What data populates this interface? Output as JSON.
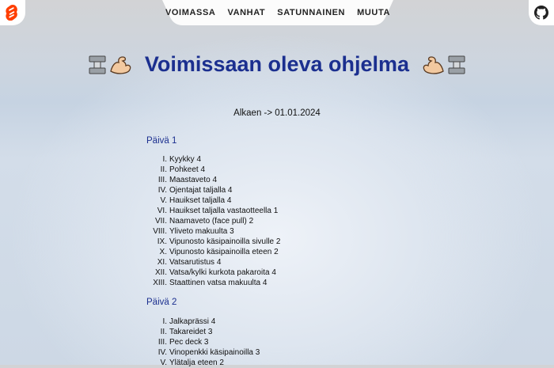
{
  "nav": {
    "items": [
      "VOIMASSA",
      "VANHAT",
      "SATUNNAINEN",
      "MUUTA"
    ]
  },
  "header": {
    "title": "Voimissaan oleva ohjelma",
    "start_label": "Alkaen -> 01.01.2024"
  },
  "days": [
    {
      "label": "Päivä 1",
      "exercises": [
        {
          "num": "I.",
          "text": "Kyykky 4"
        },
        {
          "num": "II.",
          "text": "Pohkeet 4"
        },
        {
          "num": "III.",
          "text": "Maastaveto 4"
        },
        {
          "num": "IV.",
          "text": "Ojentajat taljalla 4"
        },
        {
          "num": "V.",
          "text": "Hauikset taljalla 4"
        },
        {
          "num": "VI.",
          "text": "Hauikset taljalla vastaotteella 1"
        },
        {
          "num": "VII.",
          "text": "Naamaveto (face pull) 2"
        },
        {
          "num": "VIII.",
          "text": "Yliveto makuulta 3"
        },
        {
          "num": "IX.",
          "text": "Vipunosto käsipainoilla sivulle 2"
        },
        {
          "num": "X.",
          "text": "Vipunosto käsipainoilla eteen 2"
        },
        {
          "num": "XI.",
          "text": "Vatsarutistus 4"
        },
        {
          "num": "XII.",
          "text": "Vatsa/kylki kurkota pakaroita 4"
        },
        {
          "num": "XIII.",
          "text": "Staattinen vatsa makuulta 4"
        }
      ]
    },
    {
      "label": "Päivä 2",
      "exercises": [
        {
          "num": "I.",
          "text": "Jalkaprässi 4"
        },
        {
          "num": "II.",
          "text": "Takareidet 3"
        },
        {
          "num": "III.",
          "text": "Pec deck 3"
        },
        {
          "num": "IV.",
          "text": "Vinopenkki käsipainoilla 3"
        },
        {
          "num": "V.",
          "text": "Ylätalja eteen 2"
        }
      ]
    }
  ],
  "icons": {
    "left": "svelte-logo-icon",
    "right": "github-icon",
    "title_decor": [
      "dumbbell-icon",
      "flexed-biceps-icon"
    ]
  },
  "colors": {
    "title": "#1b2f8f",
    "svelte": "#ff3e00"
  }
}
